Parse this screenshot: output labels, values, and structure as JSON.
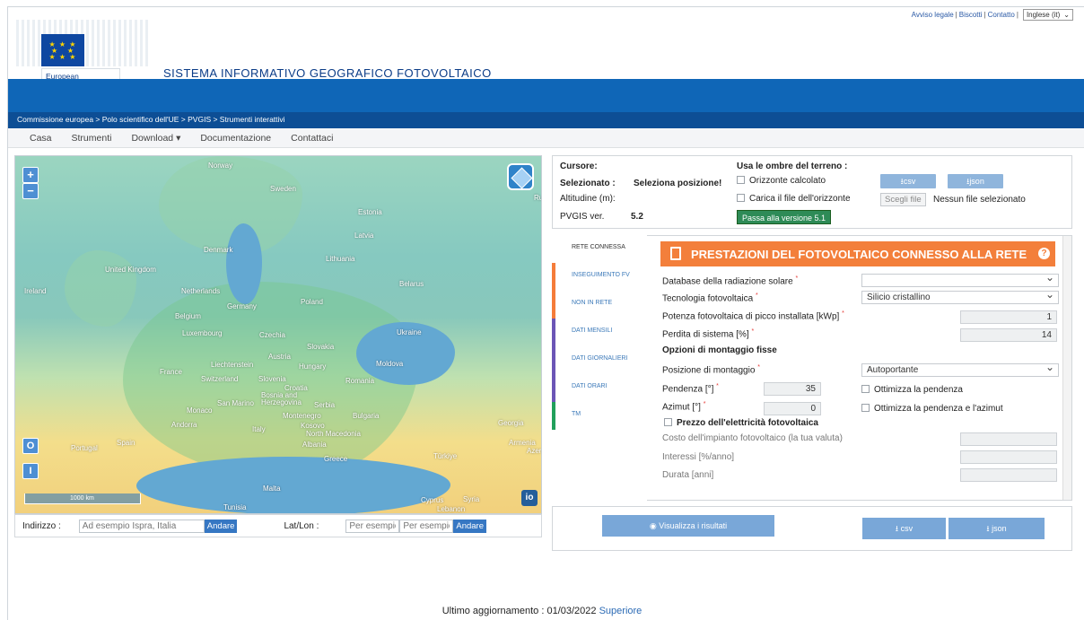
{
  "top_links": {
    "legal": "Avviso legale",
    "cookies": "Biscotti",
    "contact": "Contatto",
    "language": "Inglese (it)",
    "separator": "|"
  },
  "logo": {
    "org": "European Commission"
  },
  "site_title": "SISTEMA INFORMATIVO GEOGRAFICO FOTOVOLTAICO",
  "breadcrumb": "Commissione europea > Polo scientifico dell'UE > PVGIS > Strumenti interattivi",
  "nav": [
    "Casa",
    "Strumenti",
    "Download ▾",
    "Documentazione",
    "Contattaci"
  ],
  "map": {
    "labels": [
      "Norway",
      "Sweden",
      "Estonia",
      "Latvia",
      "Denmark",
      "Lithuania",
      "United Kingdom",
      "Ireland",
      "Netherlands",
      "Belarus",
      "Poland",
      "Germany",
      "Belgium",
      "Luxembourg",
      "Czechia",
      "Ukraine",
      "Slovakia",
      "Austria",
      "Liechtenstein",
      "Hungary",
      "Moldova",
      "France",
      "Switzerland",
      "Slovenia",
      "Romania",
      "Croatia",
      "Bosnia and Herzegovina",
      "Serbia",
      "San Marino",
      "Monaco",
      "Montenegro",
      "Bulgaria",
      "Andorra",
      "Italy",
      "Kosovo",
      "North Macedonia",
      "Georgia",
      "Spain",
      "Portugal",
      "Albania",
      "Armenia",
      "Azer",
      "Greece",
      "Türkiye",
      "Malta",
      "Cyprus",
      "Syria",
      "Lebanon",
      "Tunisia",
      "Ru"
    ],
    "scale": "1000 km",
    "io_label": "io"
  },
  "address": {
    "label": "Indirizzo :",
    "placeholder": "Ad esempio Ispra, Italia",
    "go": "Andare",
    "latlon_label": "Lat/Lon :",
    "lat_placeholder": "Per esempio",
    "lon_placeholder": "Per esempio",
    "latlon_go": "Andare"
  },
  "cursor_panel": {
    "cursor_label": "Cursore:",
    "selected_label": "Selezionato :",
    "selected_value": "Seleziona posizione!",
    "altitude_label": "Altitudine (m):",
    "version_label": "PVGIS ver.",
    "version_value": "5.2",
    "shadows_label": "Usa le ombre del terreno :",
    "horizon_calc": "Orizzonte calcolato",
    "horizon_file": "Carica il file dell'orizzonte",
    "csv": "csv",
    "json": "json",
    "choose_file": "Scegli file",
    "no_file": "Nessun file selezionato",
    "switch_version": "Passa alla versione 5.1"
  },
  "tabs": [
    {
      "label": "RETE CONNESSA",
      "color": "#ffffff"
    },
    {
      "label": "INSEGUIMENTO FV",
      "color": "#f57c3a"
    },
    {
      "label": "NON IN RETE",
      "color": "#f57c3a"
    },
    {
      "label": "DATI MENSILI",
      "color": "#6b55b6"
    },
    {
      "label": "DATI GIORNALIERI",
      "color": "#6b55b6"
    },
    {
      "label": "DATI ORARI",
      "color": "#6b55b6"
    },
    {
      "label": "TM",
      "color": "#21a05b"
    }
  ],
  "form": {
    "title": "PRESTAZIONI DEL FOTOVOLTAICO CONNESSO ALLA RETE",
    "help": "?",
    "solar_db_label": "Database della radiazione solare",
    "solar_db_value": "",
    "tech_label": "Tecnologia fotovoltaica",
    "tech_value": "Silicio cristallino",
    "peak_label": "Potenza fotovoltaica di picco installata [kWp]",
    "peak_value": "1",
    "loss_label": "Perdita di sistema [%]",
    "loss_value": "14",
    "mount_options_label": "Opzioni di montaggio fisse",
    "mount_pos_label": "Posizione di montaggio",
    "mount_pos_value": "Autoportante",
    "slope_label": "Pendenza [°]",
    "slope_value": "35",
    "optimize_slope": "Ottimizza la pendenza",
    "azimuth_label": "Azimut [°]",
    "azimuth_value": "0",
    "optimize_both": "Ottimizza la pendenza e l'azimut",
    "price_label": "Prezzo dell'elettricità fotovoltaica",
    "cost_label": "Costo dell'impianto fotovoltaico (la tua valuta)",
    "interest_label": "Interessi [%/anno]",
    "duration_label": "Durata [anni]"
  },
  "bottom": {
    "view": "Visualizza i risultati",
    "csv": "csv",
    "json": "json"
  },
  "footer": {
    "updated": "Ultimo aggiornamento : 01/03/2022",
    "top": "Superiore"
  }
}
